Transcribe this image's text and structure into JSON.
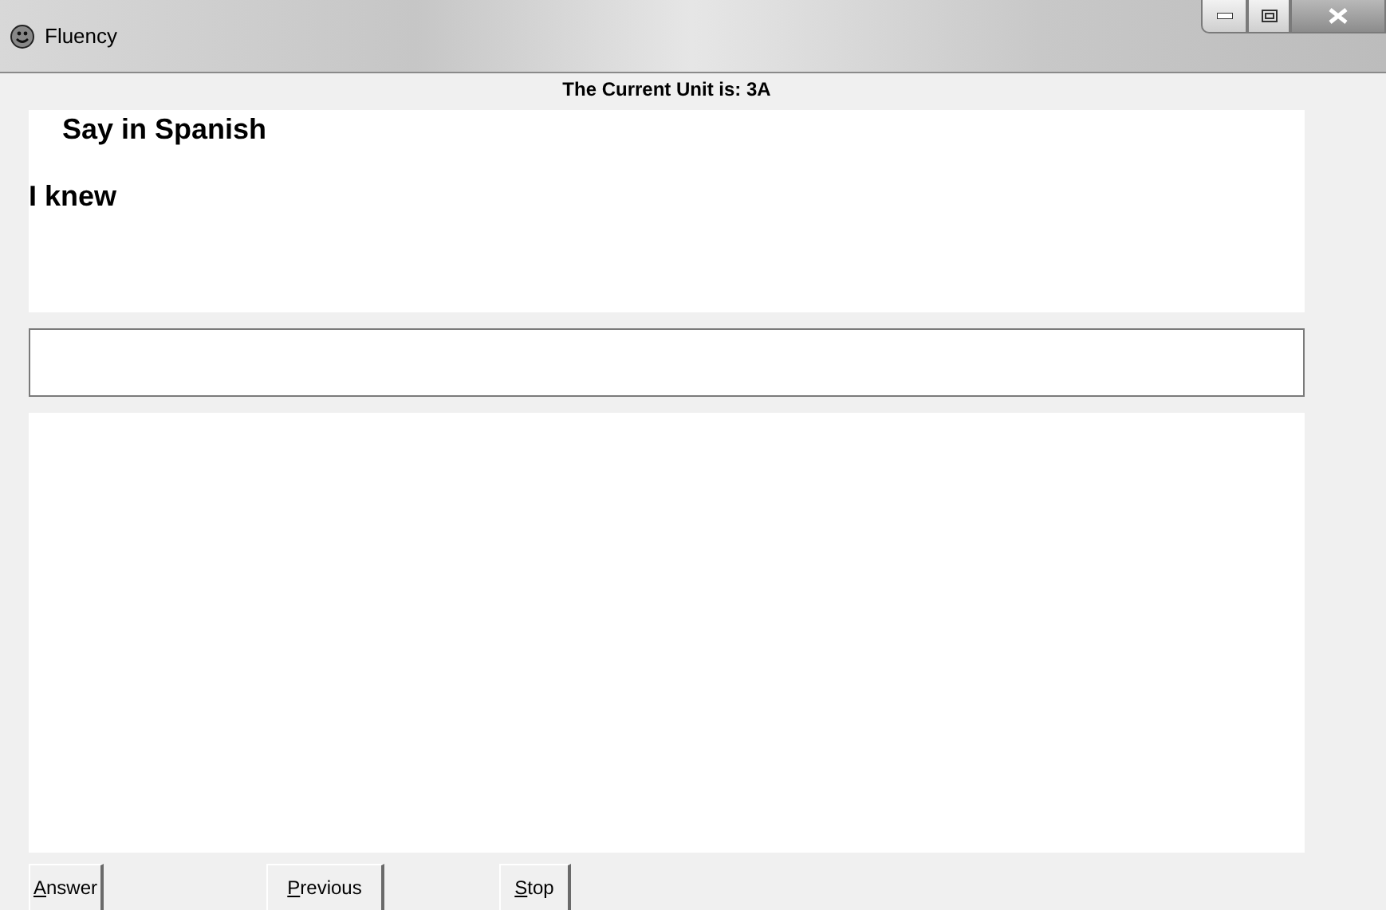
{
  "window": {
    "title": "Fluency"
  },
  "unit_label": "The Current Unit is: 3A",
  "prompt": {
    "instruction": "Say in Spanish",
    "phrase": "I knew"
  },
  "buttons": [
    "Answer",
    "Previous",
    "Stop"
  ]
}
